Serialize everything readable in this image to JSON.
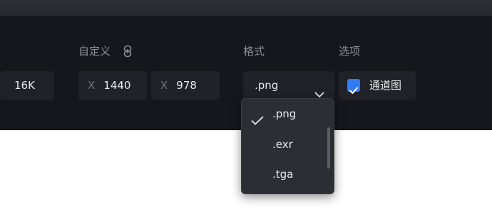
{
  "resolution": {
    "preset_value": "16K"
  },
  "custom": {
    "label": "自定义",
    "x_prefix": "X",
    "width": "1440",
    "y_prefix": "X",
    "height": "978"
  },
  "format": {
    "label": "格式",
    "selected": ".png",
    "options": [
      {
        "label": ".png",
        "checked": true
      },
      {
        "label": ".exr",
        "checked": false
      },
      {
        "label": ".tga",
        "checked": false
      }
    ]
  },
  "options": {
    "label": "选项",
    "channel_map_label": "通道图",
    "channel_map_checked": true
  },
  "colors": {
    "panel_bg": "#15171c",
    "field_bg": "#1f2228",
    "accent": "#2f7cf6",
    "dropdown_bg": "#2b2e35"
  },
  "icons": [
    "link-icon",
    "chevron-down-icon",
    "checkmark-icon"
  ]
}
